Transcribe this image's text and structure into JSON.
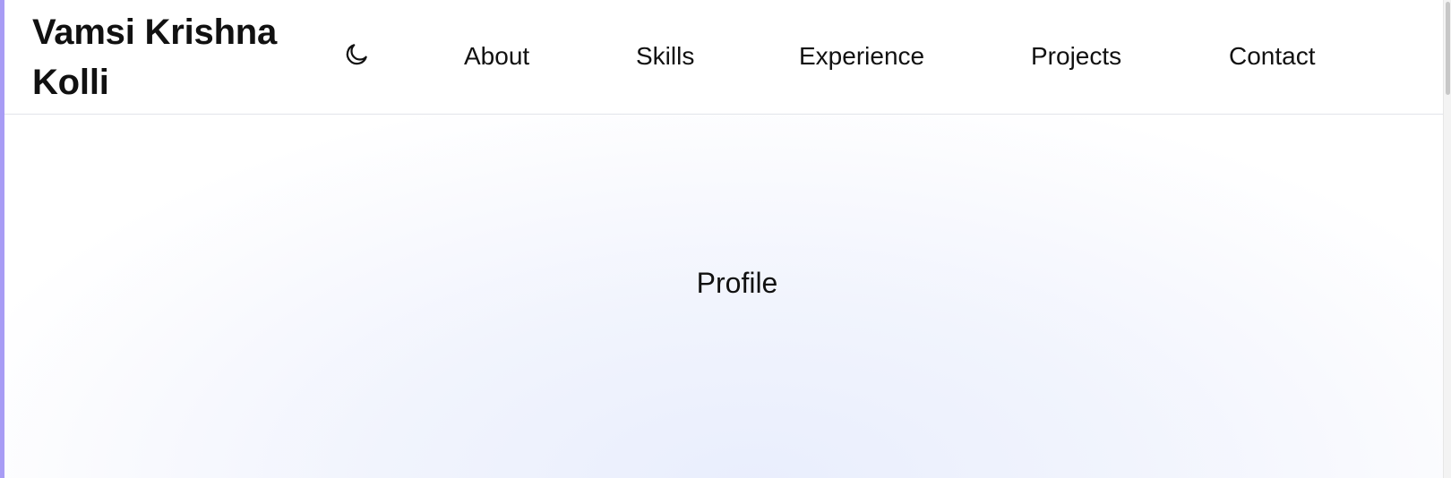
{
  "header": {
    "brand": "Vamsi Krishna\nKolli",
    "theme_toggle_icon": "moon-icon",
    "nav": [
      {
        "label": "About"
      },
      {
        "label": "Skills"
      },
      {
        "label": "Experience"
      },
      {
        "label": "Projects"
      },
      {
        "label": "Contact"
      }
    ]
  },
  "hero": {
    "profile_label": "Profile"
  },
  "colors": {
    "accent_bar": "#a89cf5",
    "text": "#111111",
    "header_bg": "#ffffff",
    "hero_gradient_center": "#e9eefd"
  }
}
